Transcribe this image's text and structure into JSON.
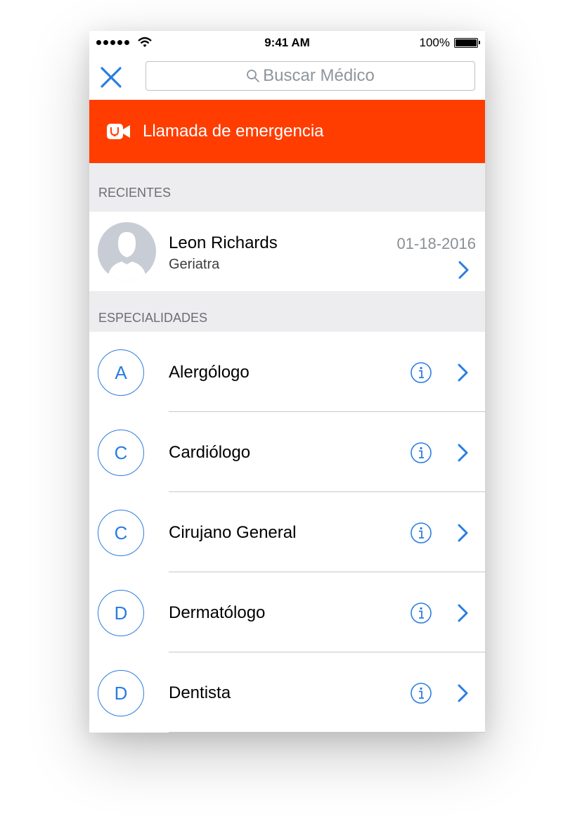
{
  "status_bar": {
    "time": "9:41 AM",
    "battery": "100%"
  },
  "navbar": {
    "search_placeholder": "Buscar Médico"
  },
  "emergency": {
    "label": "Llamada de emergencia",
    "color": "#ff3d00"
  },
  "recents": {
    "header": "RECIENTES",
    "items": [
      {
        "name": "Leon Richards",
        "specialty": "Geriatra",
        "date": "01-18-2016"
      }
    ]
  },
  "specialties": {
    "header": "ESPECIALIDADES",
    "items": [
      {
        "letter": "A",
        "name": "Alergólogo"
      },
      {
        "letter": "C",
        "name": "Cardiólogo"
      },
      {
        "letter": "C",
        "name": "Cirujano General"
      },
      {
        "letter": "D",
        "name": "Dermatólogo"
      },
      {
        "letter": "D",
        "name": "Dentista"
      }
    ]
  },
  "accent_color": "#2a7de1",
  "icons": [
    "close-icon",
    "search-icon",
    "video-call-icon",
    "chevron-right-icon",
    "info-icon",
    "avatar-placeholder-icon"
  ]
}
